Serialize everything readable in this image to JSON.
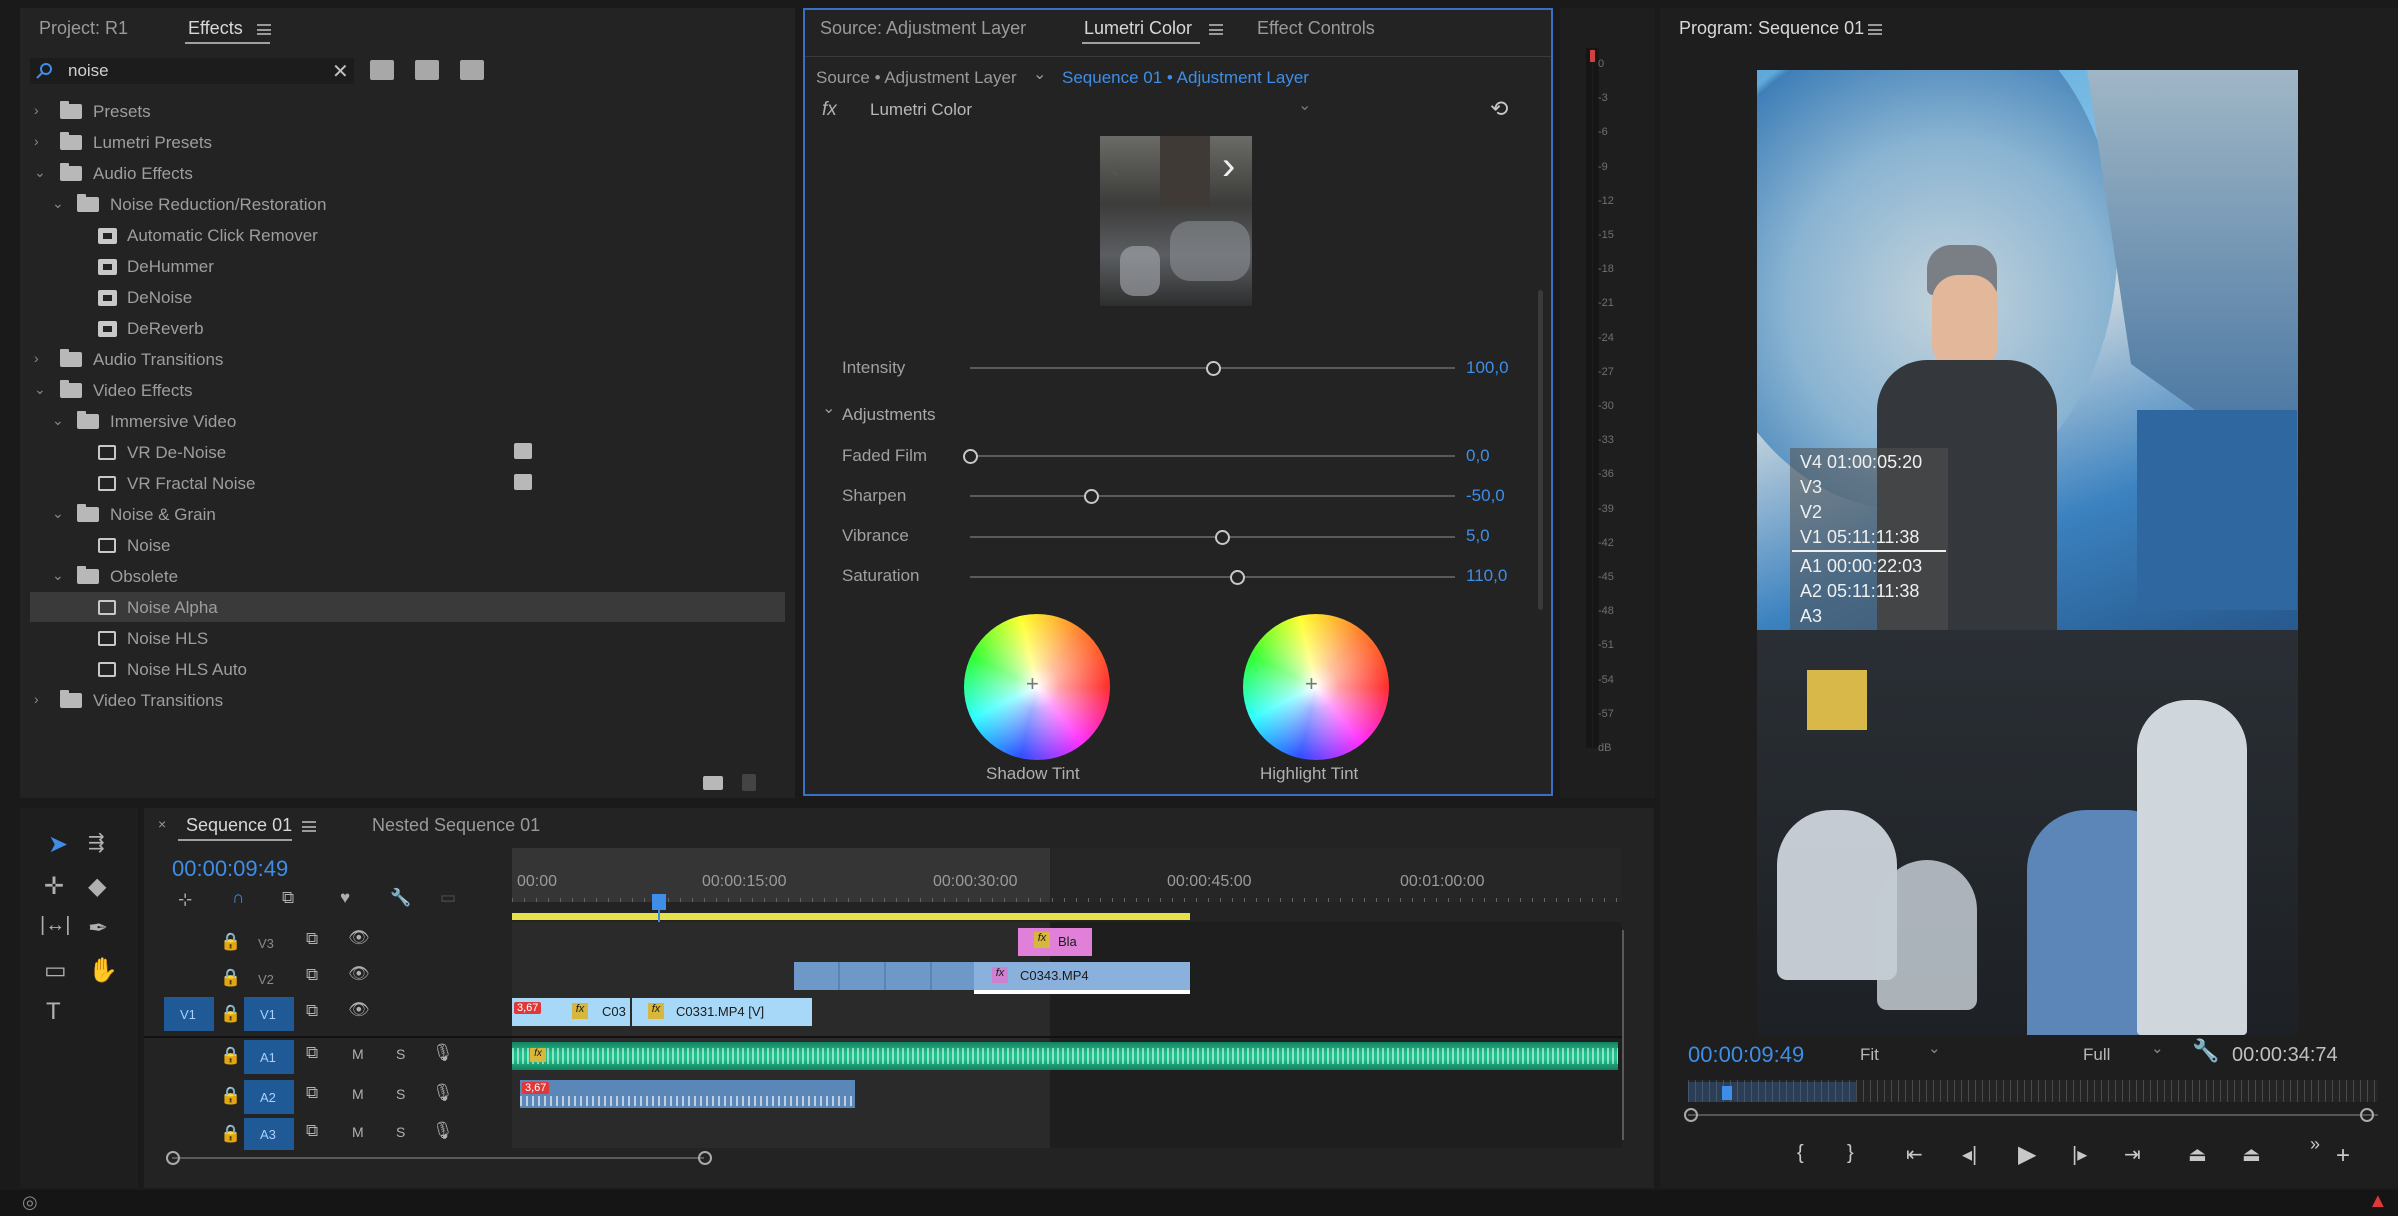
{
  "project_panel": {
    "project_tab": "Project: R1",
    "effects_tab": "Effects",
    "search_value": "noise",
    "tree": [
      {
        "label": "Presets"
      },
      {
        "label": "Lumetri Presets"
      },
      {
        "label": "Audio Effects"
      },
      {
        "label": "Noise Reduction/Restoration"
      },
      {
        "label": "Automatic Click Remover"
      },
      {
        "label": "DeHummer"
      },
      {
        "label": "DeNoise"
      },
      {
        "label": "DeReverb"
      },
      {
        "label": "Audio Transitions"
      },
      {
        "label": "Video Effects"
      },
      {
        "label": "Immersive Video"
      },
      {
        "label": "VR De-Noise"
      },
      {
        "label": "VR Fractal Noise"
      },
      {
        "label": "Noise & Grain"
      },
      {
        "label": "Noise"
      },
      {
        "label": "Obsolete"
      },
      {
        "label": "Noise Alpha"
      },
      {
        "label": "Noise HLS"
      },
      {
        "label": "Noise HLS Auto"
      },
      {
        "label": "Video Transitions"
      }
    ]
  },
  "lumetri_panel": {
    "tabs": [
      "Source: Adjustment Layer",
      "Lumetri Color",
      "Effect Controls"
    ],
    "source_label": "Source • Adjustment Layer",
    "sequence_label": "Sequence 01 • Adjustment Layer",
    "fx_label": "fx",
    "effect_name": "Lumetri Color",
    "intensity": {
      "label": "Intensity",
      "value": "100,0",
      "level": 0.5
    },
    "adjustments_label": "Adjustments",
    "sliders": [
      {
        "label": "Faded Film",
        "value": "0,0",
        "level": 0.0
      },
      {
        "label": "Sharpen",
        "value": "-50,0",
        "level": 0.25
      },
      {
        "label": "Vibrance",
        "value": "5,0",
        "level": 0.52
      },
      {
        "label": "Saturation",
        "value": "110,0",
        "level": 0.55
      }
    ],
    "shadow_tint_label": "Shadow Tint",
    "highlight_tint_label": "Highlight Tint"
  },
  "audio_meter": {
    "ticks": [
      "0",
      "-3",
      "-6",
      "-9",
      "-12",
      "-15",
      "-18",
      "-21",
      "-24",
      "-27",
      "-30",
      "-33",
      "-36",
      "-39",
      "-42",
      "-45",
      "-48",
      "-51",
      "-54",
      "-57",
      "dB"
    ]
  },
  "timeline": {
    "tabs": [
      "Sequence 01",
      "Nested Sequence 01"
    ],
    "timecode": "00:00:09:49",
    "ruler": [
      "00:00",
      "00:00:15:00",
      "00:00:30:00",
      "00:00:45:00",
      "00:01:00:00"
    ],
    "tracks": {
      "v3": "V3",
      "v2": "V2",
      "v1": "V1",
      "src_v1": "V1",
      "a1": "A1",
      "a2": "A2",
      "a3": "A3",
      "m": "M",
      "s": "S"
    },
    "clips": {
      "v3_clip": "Bla",
      "v2_clip": "C0343.MP4",
      "v1_clip_a": "C03",
      "v1_clip_b": "C0331.MP4 [V]",
      "speed_badge": "3,67",
      "fx": "fx"
    }
  },
  "program_monitor": {
    "title": "Program: Sequence 01",
    "overlay": [
      "V4 01:00:05:20",
      "V3",
      "V2",
      "V1 05:11:11:38",
      "A1 00:00:22:03",
      "A2 05:11:11:38",
      "A3"
    ],
    "timecode": "00:00:09:49",
    "zoom": "Fit",
    "quality": "Full",
    "duration": "00:00:34:74"
  }
}
